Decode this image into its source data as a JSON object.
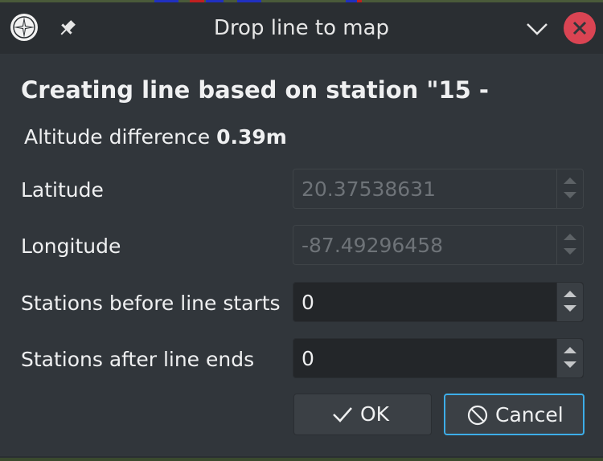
{
  "window": {
    "title": "Drop line to map",
    "icons": [
      "compass-app-icon",
      "pin-icon",
      "chevron-down-icon",
      "close-icon"
    ]
  },
  "heading": "Creating line based on station \"15 -",
  "altitude": {
    "label": "Altitude difference",
    "value": "0.39m"
  },
  "fields": [
    {
      "label": "Latitude",
      "value": "20.37538631",
      "enabled": false
    },
    {
      "label": "Longitude",
      "value": "-87.49296458",
      "enabled": false
    },
    {
      "label": "Stations before line starts",
      "value": "0",
      "enabled": true
    },
    {
      "label": "Stations after line ends",
      "value": "0",
      "enabled": true
    }
  ],
  "buttons": {
    "ok": "OK",
    "cancel": "Cancel"
  },
  "colors": {
    "close": "#da4453",
    "focus": "#3daee9",
    "background": "#31363b"
  }
}
